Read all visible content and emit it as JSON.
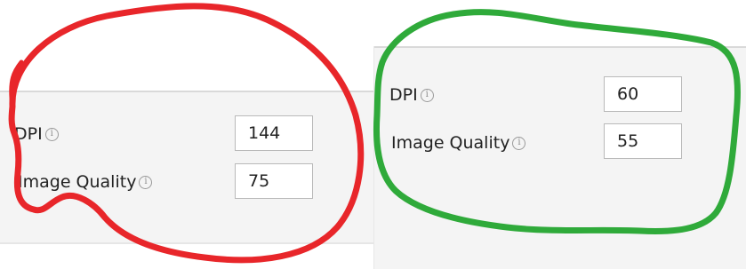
{
  "left_panel": {
    "dpi_label": "DPI",
    "dpi_value": "144",
    "quality_label": "Image Quality",
    "quality_value": "75"
  },
  "right_panel": {
    "dpi_label": "DPI",
    "dpi_value": "60",
    "quality_label": "Image Quality",
    "quality_value": "55"
  },
  "icons": {
    "info": "info-circle-icon"
  },
  "annotation_colors": {
    "left_circle": "#e8262a",
    "right_circle": "#2faa3a"
  }
}
